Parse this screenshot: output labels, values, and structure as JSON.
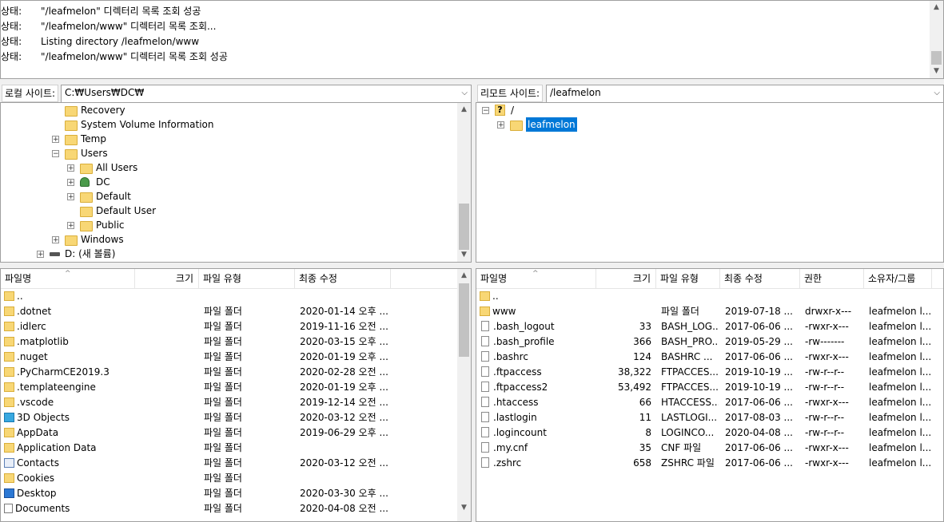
{
  "log": {
    "lines": [
      {
        "label": "상태:",
        "text": "\"/leafmelon\" 디렉터리 목록 조회 성공"
      },
      {
        "label": "상태:",
        "text": "\"/leafmelon/www\" 디렉터리 목록 조회..."
      },
      {
        "label": "상태:",
        "text": "Listing directory /leafmelon/www"
      },
      {
        "label": "상태:",
        "text": "\"/leafmelon/www\" 디렉터리 목록 조회 성공"
      }
    ]
  },
  "local": {
    "site_label": "로컬 사이트:",
    "path": "C:₩Users₩DC₩",
    "tree": [
      {
        "label": "Recovery",
        "icon": "folder-icon",
        "expander": ""
      },
      {
        "label": "System Volume Information",
        "icon": "folder-icon",
        "expander": ""
      },
      {
        "label": "Temp",
        "icon": "folder-icon",
        "expander": "+"
      },
      {
        "label": "Users",
        "icon": "folder-icon",
        "expander": "−"
      },
      {
        "label": "All Users",
        "icon": "folder-icon",
        "expander": "+"
      },
      {
        "label": "DC",
        "icon": "user-folder-icon",
        "expander": "+"
      },
      {
        "label": "Default",
        "icon": "folder-icon",
        "expander": "+"
      },
      {
        "label": "Default User",
        "icon": "folder-icon",
        "expander": ""
      },
      {
        "label": "Public",
        "icon": "folder-icon",
        "expander": "+"
      },
      {
        "label": "Windows",
        "icon": "folder-icon",
        "expander": "+"
      },
      {
        "label": "D: (새 볼륨)",
        "icon": "drive-icon",
        "expander": "+"
      }
    ],
    "columns": [
      "파일명",
      "크기",
      "파일 유형",
      "최종 수정"
    ],
    "files": [
      {
        "name": "..",
        "size": "",
        "type": "",
        "modified": "",
        "icon": "folder-icon"
      },
      {
        "name": ".dotnet",
        "size": "",
        "type": "파일 폴더",
        "modified": "2020-01-14 오후 ...",
        "icon": "folder-icon"
      },
      {
        "name": ".idlerc",
        "size": "",
        "type": "파일 폴더",
        "modified": "2019-11-16 오전 ...",
        "icon": "folder-icon"
      },
      {
        "name": ".matplotlib",
        "size": "",
        "type": "파일 폴더",
        "modified": "2020-03-15 오후 ...",
        "icon": "folder-icon"
      },
      {
        "name": ".nuget",
        "size": "",
        "type": "파일 폴더",
        "modified": "2020-01-19 오후 ...",
        "icon": "folder-icon"
      },
      {
        "name": ".PyCharmCE2019.3",
        "size": "",
        "type": "파일 폴더",
        "modified": "2020-02-28 오전 ...",
        "icon": "folder-icon"
      },
      {
        "name": ".templateengine",
        "size": "",
        "type": "파일 폴더",
        "modified": "2020-01-19 오후 ...",
        "icon": "folder-icon"
      },
      {
        "name": ".vscode",
        "size": "",
        "type": "파일 폴더",
        "modified": "2019-12-14 오전 ...",
        "icon": "folder-icon"
      },
      {
        "name": "3D Objects",
        "size": "",
        "type": "파일 폴더",
        "modified": "2020-03-12 오전 ...",
        "icon": "cube-icon"
      },
      {
        "name": "AppData",
        "size": "",
        "type": "파일 폴더",
        "modified": "2019-06-29 오후 ...",
        "icon": "folder-icon"
      },
      {
        "name": "Application Data",
        "size": "",
        "type": "파일 폴더",
        "modified": "",
        "icon": "folder-icon"
      },
      {
        "name": "Contacts",
        "size": "",
        "type": "파일 폴더",
        "modified": "2020-03-12 오전 ...",
        "icon": "contacts-icon"
      },
      {
        "name": "Cookies",
        "size": "",
        "type": "파일 폴더",
        "modified": "",
        "icon": "folder-icon"
      },
      {
        "name": "Desktop",
        "size": "",
        "type": "파일 폴더",
        "modified": "2020-03-30 오후 ...",
        "icon": "desktop-icon"
      },
      {
        "name": "Documents",
        "size": "",
        "type": "파일 폴더",
        "modified": "2020-04-08 오전 ...",
        "icon": "documents-icon"
      }
    ]
  },
  "remote": {
    "site_label": "리모트 사이트:",
    "path": "/leafmelon",
    "tree": [
      {
        "label": "/",
        "icon": "unknown-folder-icon",
        "expander": "−"
      },
      {
        "label": "leafmelon",
        "icon": "folder-icon",
        "expander": "+",
        "selected": true
      }
    ],
    "columns": [
      "파일명",
      "크기",
      "파일 유형",
      "최종 수정",
      "권한",
      "소유자/그룹"
    ],
    "files": [
      {
        "name": "..",
        "size": "",
        "type": "",
        "modified": "",
        "perm": "",
        "owner": "",
        "icon": "folder-icon"
      },
      {
        "name": "www",
        "size": "",
        "type": "파일 폴더",
        "modified": "2019-07-18 ...",
        "perm": "drwxr-x---",
        "owner": "leafmelon l...",
        "icon": "folder-icon"
      },
      {
        "name": ".bash_logout",
        "size": "33",
        "type": "BASH_LOG...",
        "modified": "2017-06-06 ...",
        "perm": "-rwxr-x---",
        "owner": "leafmelon l...",
        "icon": "file-icon"
      },
      {
        "name": ".bash_profile",
        "size": "366",
        "type": "BASH_PRO...",
        "modified": "2019-05-29 ...",
        "perm": "-rw-------",
        "owner": "leafmelon l...",
        "icon": "file-icon"
      },
      {
        "name": ".bashrc",
        "size": "124",
        "type": "BASHRC ...",
        "modified": "2017-06-06 ...",
        "perm": "-rwxr-x---",
        "owner": "leafmelon l...",
        "icon": "file-icon"
      },
      {
        "name": ".ftpaccess",
        "size": "38,322",
        "type": "FTPACCES...",
        "modified": "2019-10-19 ...",
        "perm": "-rw-r--r--",
        "owner": "leafmelon l...",
        "icon": "file-icon"
      },
      {
        "name": ".ftpaccess2",
        "size": "53,492",
        "type": "FTPACCES...",
        "modified": "2019-10-19 ...",
        "perm": "-rw-r--r--",
        "owner": "leafmelon l...",
        "icon": "file-icon"
      },
      {
        "name": ".htaccess",
        "size": "66",
        "type": "HTACCESS...",
        "modified": "2017-06-06 ...",
        "perm": "-rwxr-x---",
        "owner": "leafmelon l...",
        "icon": "file-icon"
      },
      {
        "name": ".lastlogin",
        "size": "11",
        "type": "LASTLOGI...",
        "modified": "2017-08-03 ...",
        "perm": "-rw-r--r--",
        "owner": "leafmelon l...",
        "icon": "file-icon"
      },
      {
        "name": ".logincount",
        "size": "8",
        "type": "LOGINCO...",
        "modified": "2020-04-08 ...",
        "perm": "-rw-r--r--",
        "owner": "leafmelon l...",
        "icon": "file-icon"
      },
      {
        "name": ".my.cnf",
        "size": "35",
        "type": "CNF 파일",
        "modified": "2017-06-06 ...",
        "perm": "-rwxr-x---",
        "owner": "leafmelon l...",
        "icon": "file-icon"
      },
      {
        "name": ".zshrc",
        "size": "658",
        "type": "ZSHRC 파일",
        "modified": "2017-06-06 ...",
        "perm": "-rwxr-x---",
        "owner": "leafmelon l...",
        "icon": "file-icon"
      }
    ]
  }
}
